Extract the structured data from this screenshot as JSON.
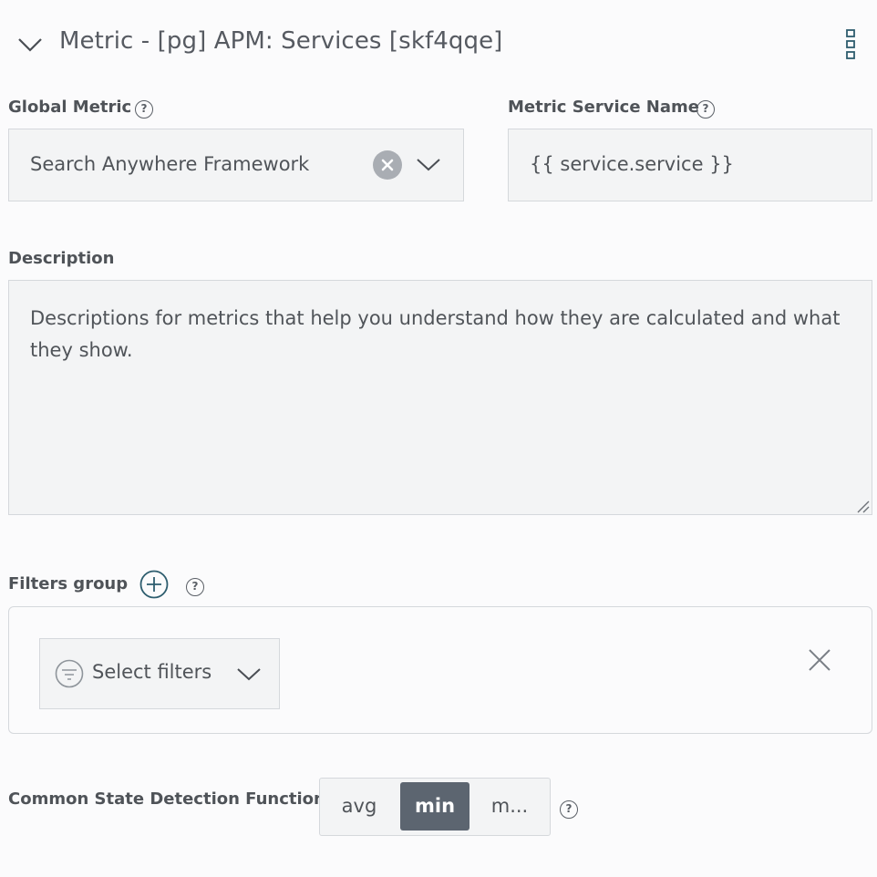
{
  "header": {
    "title": "Metric - [pg] APM: Services [skf4qqe]",
    "collapse_icon": "chevron-down-icon",
    "menu_icon": "kebab-menu-icon"
  },
  "global_metric": {
    "label": "Global Metric",
    "value": "Search Anywhere Framework",
    "help": "?"
  },
  "metric_service_name": {
    "label": "Metric Service Name",
    "value": "{{ service.service }}",
    "help": "?"
  },
  "description": {
    "label": "Description",
    "value": "Descriptions for metrics that help you understand how they are calculated and what they show."
  },
  "filters_group": {
    "label": "Filters group",
    "help": "?",
    "select_label": "Select filters"
  },
  "state_detection": {
    "label": "Common State Detection Function",
    "options": [
      "avg",
      "min",
      "m..."
    ],
    "selected": "min",
    "help": "?"
  },
  "colors": {
    "accent": "#2d5d6e",
    "active_segment": "#5c6570",
    "field_bg": "#f3f4f5",
    "border": "#d5d8dc"
  }
}
